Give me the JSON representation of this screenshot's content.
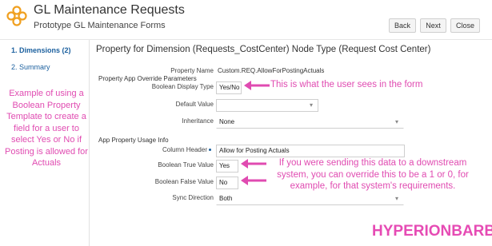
{
  "header": {
    "title": "GL Maintenance Requests",
    "subtitle": "Prototype GL Maintenance Forms",
    "buttons": {
      "back": "Back",
      "next": "Next",
      "close": "Close"
    }
  },
  "sidebar": {
    "items": [
      {
        "label": "1. Dimensions (2)",
        "active": true
      },
      {
        "label": "2. Summary",
        "active": false
      }
    ]
  },
  "panel": {
    "title": "Property for Dimension (Requests_CostCenter) Node Type (Request Cost Center)",
    "property_name_label": "Property Name",
    "property_name_value": "Custom.REQ.AllowForPostingActuals",
    "override_section": "Property App Override Parameters",
    "boolean_display_type_label": "Boolean Display Type",
    "boolean_display_type_value": "Yes/No",
    "default_value_label": "Default Value",
    "default_value_value": "",
    "inheritance_label": "Inheritance",
    "inheritance_value": "None",
    "usage_section": "App Property Usage Info",
    "column_header_label": "Column Header",
    "column_header_value": "Allow for Posting Actuals",
    "boolean_true_label": "Boolean True Value",
    "boolean_true_value": "Yes",
    "boolean_false_label": "Boolean False Value",
    "boolean_false_value": "No",
    "sync_direction_label": "Sync Direction",
    "sync_direction_value": "Both"
  },
  "annotations": {
    "left_note": "Example of using a Boolean Property Template to create a field for a user to select Yes or No if Posting is allowed for Actuals",
    "top_note": "This is what the user sees in the form",
    "bottom_note": "If you were sending this data to a downstream system, you can override this to be a 1 or 0, for example, for that system's requirements.",
    "color": "#e04bb1"
  },
  "watermark": "HYPERIONBARBIE",
  "colors": {
    "accent": "#1a5f9e",
    "logo": "#f0a020",
    "annotation": "#e04bb1"
  }
}
